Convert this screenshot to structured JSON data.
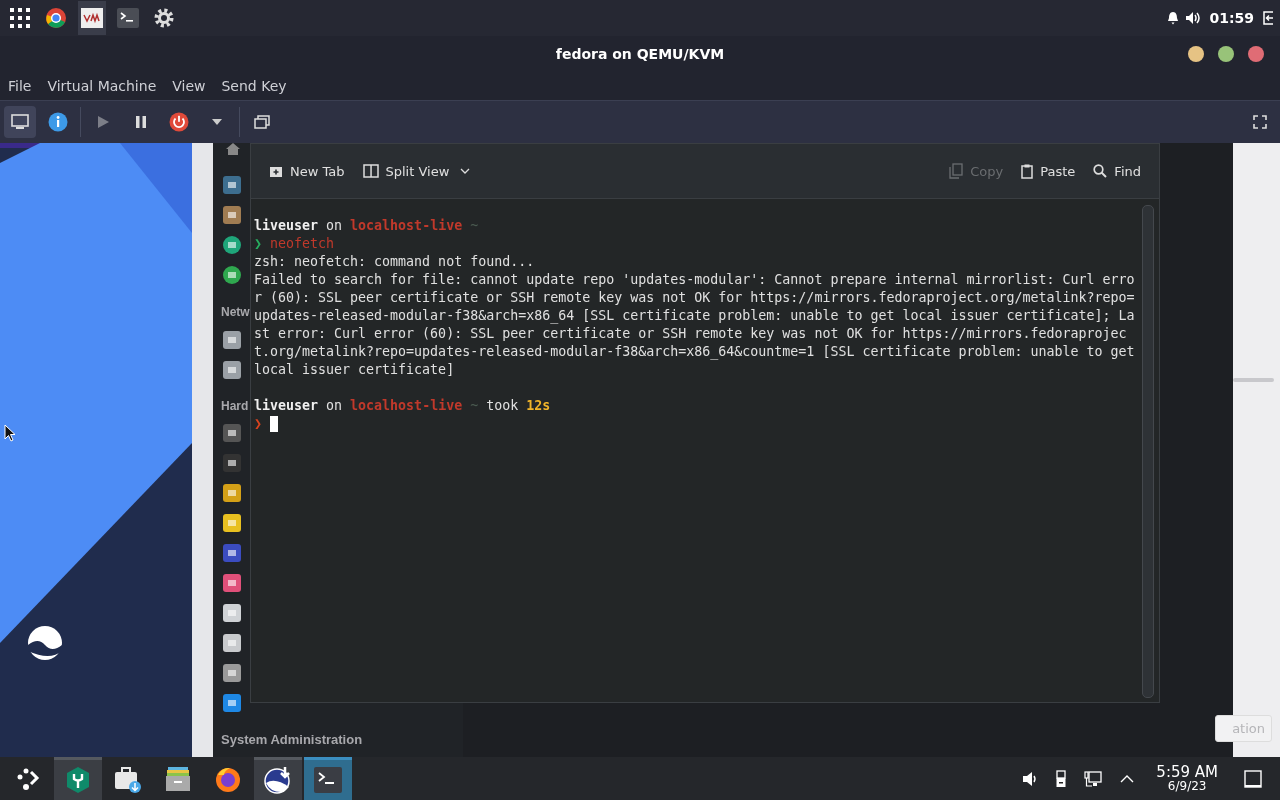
{
  "host_panel": {
    "launchers": [
      {
        "kind": "grid",
        "selected": false
      },
      {
        "kind": "browser",
        "selected": false
      },
      {
        "kind": "vmm",
        "selected": true
      },
      {
        "kind": "terminal",
        "selected": false
      },
      {
        "kind": "settings",
        "selected": false
      }
    ],
    "clock": "01:59"
  },
  "window": {
    "title": "fedora on QEMU/KVM"
  },
  "menu": [
    "File",
    "Virtual Machine",
    "View",
    "Send Key"
  ],
  "toolbar": {
    "views": [
      {
        "kind": "console",
        "selected": true
      },
      {
        "kind": "details",
        "selected": false
      }
    ],
    "controls": [
      {
        "kind": "run",
        "disabled": true
      },
      {
        "kind": "pause",
        "disabled": false
      },
      {
        "kind": "shutdown",
        "disabled": false
      }
    ]
  },
  "guest": {
    "settings_window": {
      "sections": [
        {
          "header": "Netw"
        },
        {
          "header": "Hard"
        },
        {
          "header": "System Administration"
        }
      ],
      "button": "ation"
    },
    "terminal": {
      "toolbar": [
        {
          "kind": "new-tab",
          "label": "New Tab",
          "disabled": false
        },
        {
          "kind": "split-view",
          "label": "Split View",
          "disabled": false
        },
        {
          "kind": "copy",
          "label": "Copy",
          "disabled": true
        },
        {
          "kind": "paste",
          "label": "Paste",
          "disabled": false
        },
        {
          "kind": "find",
          "label": "Find",
          "disabled": false
        }
      ],
      "lines": [
        {
          "kind": "prompt_info",
          "user": "liveuser",
          "word": "on",
          "host": "localhost-live",
          "dir": "~"
        },
        {
          "kind": "command",
          "symbol": "❯",
          "command": "neofetch",
          "success": true,
          "cursor": false
        },
        {
          "kind": "output",
          "text": "zsh: neofetch: command not found..."
        },
        {
          "kind": "output",
          "text": "Failed to search for file: cannot update repo 'updates-modular': Cannot prepare internal mirrorlist: Curl error (60): SSL peer certificate or SSH remote key was not OK for https://mirrors.fedoraproject.org/metalink?repo=updates-released-modular-f38&arch=x86_64 [SSL certificate problem: unable to get local issuer certificate]; Last error: Curl error (60): SSL peer certificate or SSH remote key was not OK for https://mirrors.fedoraproject.org/metalink?repo=updates-released-modular-f38&arch=x86_64&countme=1 [SSL certificate problem: unable to get local issuer certificate]"
        },
        {
          "kind": "prompt_info",
          "user": "liveuser",
          "word": "on",
          "host": "localhost-live",
          "dir": "~",
          "took_label": "took",
          "duration": "12s"
        },
        {
          "kind": "command",
          "symbol": "❯",
          "success": false,
          "cursor": true
        }
      ]
    },
    "taskbar": {
      "tasks": [
        {
          "kind": "wrench",
          "open": true,
          "selected": false
        },
        {
          "kind": "store",
          "open": false,
          "selected": false
        },
        {
          "kind": "files",
          "open": false,
          "selected": false
        },
        {
          "kind": "firefox",
          "open": false,
          "selected": false
        },
        {
          "kind": "installer",
          "open": true,
          "selected": false
        },
        {
          "kind": "terminal",
          "open": true,
          "selected": true
        }
      ],
      "time": "5:59 AM",
      "date": "6/9/23"
    }
  }
}
